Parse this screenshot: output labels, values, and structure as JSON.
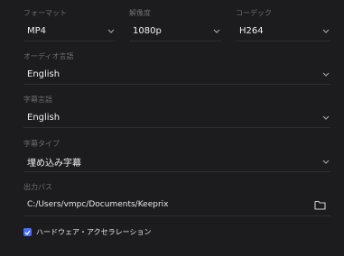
{
  "format": {
    "label": "フォーマット",
    "value": "MP4"
  },
  "resolution": {
    "label": "解像度",
    "value": "1080p"
  },
  "codec": {
    "label": "コーデック",
    "value": "H264"
  },
  "audio_language": {
    "label": "オーディオ言語",
    "value": "English"
  },
  "subtitle_language": {
    "label": "字幕言語",
    "value": "English"
  },
  "subtitle_type": {
    "label": "字幕タイプ",
    "value": "埋め込み字幕"
  },
  "output_path": {
    "label": "出力パス",
    "value": "C:/Users/vmpc/Documents/Keeprix"
  },
  "hardware_acceleration": {
    "label": "ハードウェア・アクセラレーション",
    "checked": true
  },
  "colors": {
    "background": "#1c1c1e",
    "accent": "#4a6cf7",
    "label": "#6c6c72",
    "divider": "#2e2e32"
  },
  "icons": {
    "dropdown": "chevron-down-icon",
    "folder": "folder-icon",
    "check": "check-icon"
  }
}
